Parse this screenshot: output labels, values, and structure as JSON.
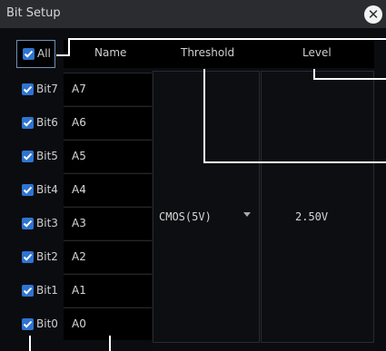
{
  "dialog": {
    "title": "Bit Setup",
    "close_icon": "close-x-circle-icon"
  },
  "header": {
    "all_label": "All",
    "name": "Name",
    "threshold": "Threshold",
    "level": "Level"
  },
  "bits": [
    {
      "label": "Bit7",
      "name": "A7",
      "checked": true
    },
    {
      "label": "Bit6",
      "name": "A6",
      "checked": true
    },
    {
      "label": "Bit5",
      "name": "A5",
      "checked": true
    },
    {
      "label": "Bit4",
      "name": "A4",
      "checked": true
    },
    {
      "label": "Bit3",
      "name": "A3",
      "checked": true
    },
    {
      "label": "Bit2",
      "name": "A2",
      "checked": true
    },
    {
      "label": "Bit1",
      "name": "A1",
      "checked": true
    },
    {
      "label": "Bit0",
      "name": "A0",
      "checked": true
    }
  ],
  "threshold": {
    "value": "CMOS(5V)",
    "dropdown_icon": "triangle-down-icon"
  },
  "level": {
    "value": "2.50V"
  },
  "colors": {
    "background": "#0b0c10",
    "titlebar": "#2b2c30",
    "checkbox": "#2f74d0",
    "text": "#d7d7d7",
    "callout": "#ffffff"
  }
}
